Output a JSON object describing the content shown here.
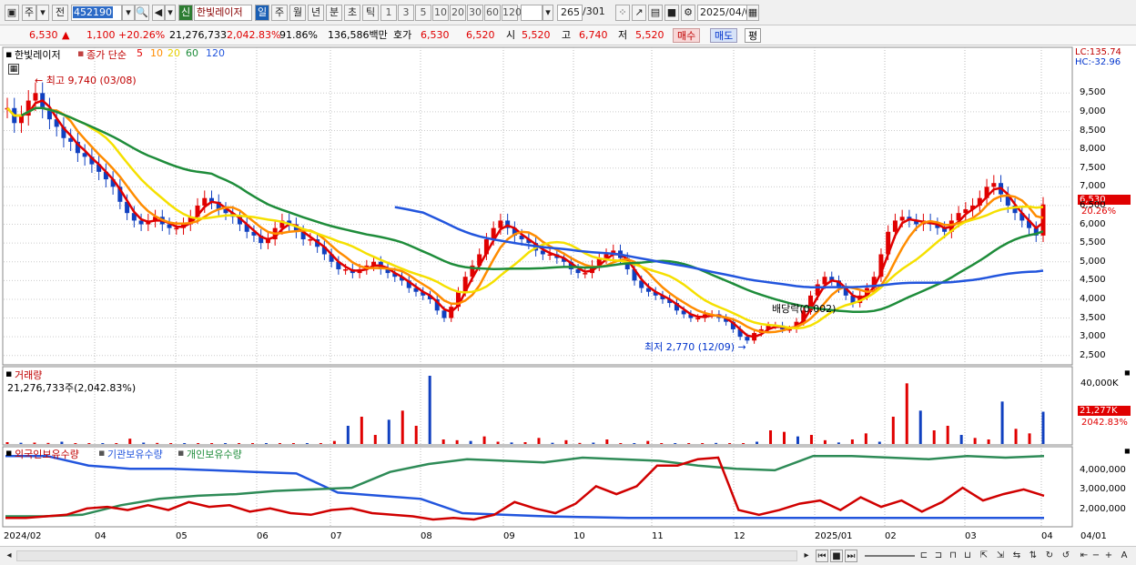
{
  "toolbar": {
    "market": "주",
    "full": "전",
    "code": "452190",
    "new_badge": "신",
    "stock_name": "한빛레이저",
    "period_day": "일",
    "period_week": "주",
    "period_month": "월",
    "period_year": "년",
    "period_min": "분",
    "period_sec": "초",
    "period_tick": "틱",
    "intervals": [
      "1",
      "3",
      "5",
      "10",
      "20",
      "30",
      "60",
      "120"
    ],
    "count": "265",
    "total": "/301",
    "date": "2025/04/01"
  },
  "quote": {
    "price": "6,530",
    "change": "1,100",
    "change_pct": "+20.26%",
    "volume": "21,276,733",
    "vol_pct": "2,042.83%",
    "ratio": "91.86%",
    "amount": "136,586백만",
    "hoga_label": "호가",
    "hoga_value": "6,530",
    "hoga_value2": "6,520",
    "open_label": "시",
    "open": "5,520",
    "high_label": "고",
    "high": "6,740",
    "low_label": "저",
    "low": "5,520",
    "buy": "매수",
    "sell": "매도",
    "avg": "평"
  },
  "price_panel": {
    "title": "한빛레이저",
    "legend_prefix": "종가 단순",
    "ma": [
      {
        "label": "5",
        "color": "#e00000"
      },
      {
        "label": "10",
        "color": "#ff8c00"
      },
      {
        "label": "20",
        "color": "#f5e000"
      },
      {
        "label": "60",
        "color": "#1e8c3a"
      },
      {
        "label": "120",
        "color": "#2255dd"
      }
    ],
    "high_note": "최고 9,740 (03/08)",
    "low_note": "최저 2,770 (12/09)",
    "dividend_note": "배당락(0.002)",
    "lc": "LC:135.74",
    "hc": "HC:-32.96",
    "axis_ticks": [
      "9,500",
      "9,000",
      "8,500",
      "8,000",
      "7,500",
      "7,000",
      "6,500",
      "6,000",
      "5,500",
      "5,000",
      "4,500",
      "4,000",
      "3,500",
      "3,000",
      "2,500"
    ],
    "last_price_tag": "6,530",
    "last_pct_tag": "20.26%"
  },
  "volume_panel": {
    "title": "거래량",
    "value": "21,276,733주(2,042.83%)",
    "axis_tick": "40,000K",
    "last_tag": "21,277K",
    "last_pct": "2042.83%"
  },
  "holdings_panel": {
    "legend_foreign": "외국인보유수량",
    "legend_inst": "기관보유수량",
    "legend_indiv": "개인보유수량",
    "axis_ticks": [
      "4,000,000",
      "3,000,000",
      "2,000,000"
    ]
  },
  "x_axis": {
    "labels": [
      "2024/02",
      "04",
      "05",
      "06",
      "07",
      "08",
      "09",
      "10",
      "11",
      "12",
      "2025/01",
      "02",
      "03",
      "04"
    ],
    "right_label": "04/01"
  },
  "chart_data": {
    "type": "candlestick",
    "x_range": [
      "2024/02",
      "2025/04/01"
    ],
    "ylim": [
      2500,
      9750
    ],
    "closes": [
      9100,
      8700,
      8900,
      9300,
      9500,
      9100,
      8800,
      8600,
      8300,
      8200,
      7900,
      7800,
      7600,
      7400,
      7200,
      7000,
      6600,
      6300,
      6100,
      6000,
      6100,
      6200,
      6000,
      5900,
      5900,
      6000,
      6200,
      6500,
      6700,
      6600,
      6400,
      6300,
      6200,
      6000,
      5800,
      5700,
      5500,
      5600,
      5900,
      6100,
      6000,
      5800,
      5600,
      5600,
      5400,
      5200,
      5000,
      4800,
      4800,
      4700,
      4800,
      4900,
      5000,
      4800,
      4700,
      4600,
      4500,
      4300,
      4200,
      4100,
      4000,
      3700,
      3500,
      3800,
      4200,
      4600,
      4900,
      5200,
      5600,
      5900,
      6100,
      5900,
      5700,
      5600,
      5500,
      5300,
      5200,
      5200,
      5100,
      5000,
      4800,
      4700,
      4700,
      4900,
      5100,
      5200,
      5300,
      5100,
      4800,
      4500,
      4300,
      4200,
      4100,
      4000,
      3900,
      3700,
      3600,
      3500,
      3500,
      3600,
      3600,
      3500,
      3400,
      3200,
      3000,
      2900,
      3100,
      3200,
      3300,
      3300,
      3200,
      3200,
      3400,
      3700,
      4100,
      4400,
      4600,
      4500,
      4300,
      4100,
      3900,
      4100,
      4300,
      4600,
      5200,
      5800,
      6100,
      6200,
      6100,
      6000,
      6100,
      6000,
      5900,
      5800,
      6100,
      6300,
      6400,
      6500,
      6700,
      7000,
      7100,
      6800,
      6500,
      6300,
      6100,
      5900,
      5700,
      6530
    ],
    "ma5_sample": [
      9000,
      8800,
      8000,
      6900,
      6100,
      6000,
      6400,
      6000,
      5500,
      4800,
      4600,
      4200,
      3600,
      4700,
      5900,
      5200,
      4900,
      4700,
      3600,
      3400,
      3000,
      3300,
      4400,
      4200,
      6000,
      6100,
      6700,
      6100,
      6000
    ],
    "volumes_k": [
      1200,
      800,
      900,
      700,
      1500,
      600,
      500,
      400,
      600,
      3500,
      900,
      700,
      600,
      500,
      500,
      400,
      600,
      300,
      500,
      400,
      300,
      400,
      350,
      300,
      2000,
      12000,
      18000,
      6000,
      16000,
      22000,
      12000,
      45000,
      3000,
      2500,
      2000,
      5000,
      1500,
      1000,
      1200,
      4000,
      800,
      2500,
      700,
      900,
      3000,
      600,
      600,
      2000,
      500,
      600,
      400,
      500,
      700,
      400,
      500,
      1500,
      9000,
      8000,
      5000,
      6000,
      2500,
      1000,
      3000,
      7000,
      1500,
      18000,
      40000,
      22000,
      9000,
      12000,
      6000,
      4000,
      3000,
      28000,
      10000,
      7000,
      21277
    ],
    "foreign_holdings": [
      500000,
      500000,
      600000,
      700000,
      1100000,
      1200000,
      1000000,
      1300000,
      1000000,
      1500000,
      1200000,
      1300000,
      900000,
      1100000,
      800000,
      700000,
      1000000,
      1100000,
      800000,
      700000,
      600000,
      400000,
      500000,
      400000,
      700000,
      1500000,
      1100000,
      800000,
      1400000,
      2500000,
      2000000,
      2500000,
      3800000,
      3800000,
      4200000,
      4300000,
      1000000,
      700000,
      1000000,
      1400000,
      1600000,
      1000000,
      1800000,
      1200000,
      1600000,
      900000,
      1500000,
      2400000,
      1600000,
      2000000,
      2300000,
      1900000
    ],
    "inst_holdings": [
      4400000,
      4400000,
      3800000,
      3600000,
      3600000,
      3500000,
      3400000,
      3300000,
      2100000,
      1900000,
      1700000,
      800000,
      700000,
      600000,
      550000,
      500000,
      500000,
      500000,
      500000,
      500000,
      500000,
      500000,
      500000,
      500000,
      500000,
      500000
    ],
    "indiv_holdings": [
      600000,
      600000,
      700000,
      1300000,
      1700000,
      1900000,
      2000000,
      2200000,
      2300000,
      2400000,
      3400000,
      3900000,
      4200000,
      4100000,
      4000000,
      4300000,
      4200000,
      4100000,
      3800000,
      3600000,
      3500000,
      4400000,
      4400000,
      4300000,
      4200000,
      4400000,
      4300000,
      4400000
    ]
  }
}
